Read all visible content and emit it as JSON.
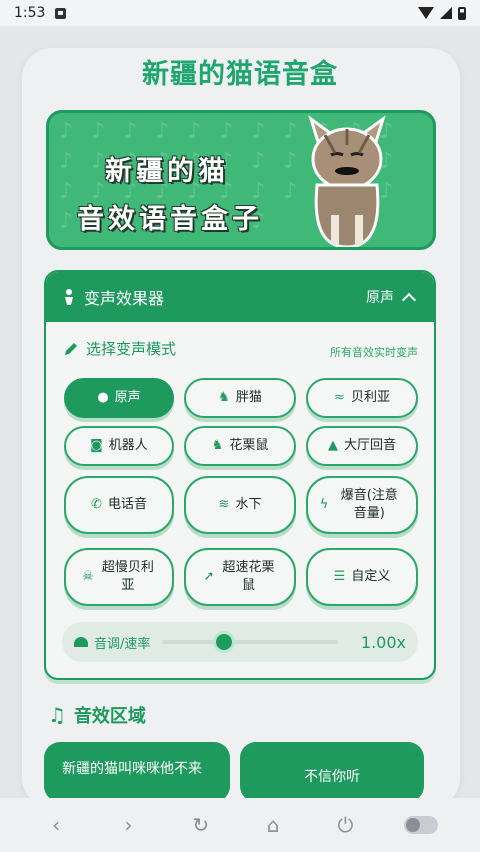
{
  "status": {
    "time": "1:53"
  },
  "title": "新疆的猫语音盒",
  "banner": {
    "line1": "新疆的猫",
    "line2": "音效语音盒子",
    "pattern": "♪♪♪♪♪♪♪♪♪♪♪♪♪♪♪♪♪♪♪♪♪♪♪♪♪♪♪♪♪♪♪♪♪♪♪♪♪♪♪♪"
  },
  "panel": {
    "title": "变声效果器",
    "current_mode": "原声",
    "subtitle": "选择变声模式",
    "hint": "所有音效实时变声",
    "modes": [
      {
        "label": "原声",
        "icon": "user-icon",
        "active": true
      },
      {
        "label": "胖猫",
        "icon": "cat-icon"
      },
      {
        "label": "贝利亚",
        "icon": "dragon-icon"
      },
      {
        "label": "机器人",
        "icon": "robot-icon"
      },
      {
        "label": "花栗鼠",
        "icon": "cat-icon"
      },
      {
        "label": "大厅回音",
        "icon": "triangle-icon"
      },
      {
        "label": "电话音",
        "icon": "phone-icon"
      },
      {
        "label": "水下",
        "icon": "water-icon"
      },
      {
        "label": "爆音(注意音量)",
        "icon": "bolt-icon"
      },
      {
        "label": "超慢贝利亚",
        "icon": "skull-icon"
      },
      {
        "label": "超速花栗鼠",
        "icon": "rocket-icon"
      },
      {
        "label": "自定义",
        "icon": "sliders-icon"
      }
    ],
    "slider": {
      "label": "音调/速率",
      "value": "1.00x",
      "position": 0.35
    }
  },
  "sound_section": {
    "title": "音效区域",
    "cards": [
      "新疆的猫叫咪咪他不来",
      "不信你听"
    ]
  },
  "colors": {
    "accent": "#1e9a5f",
    "accent_light": "#3fb878"
  }
}
